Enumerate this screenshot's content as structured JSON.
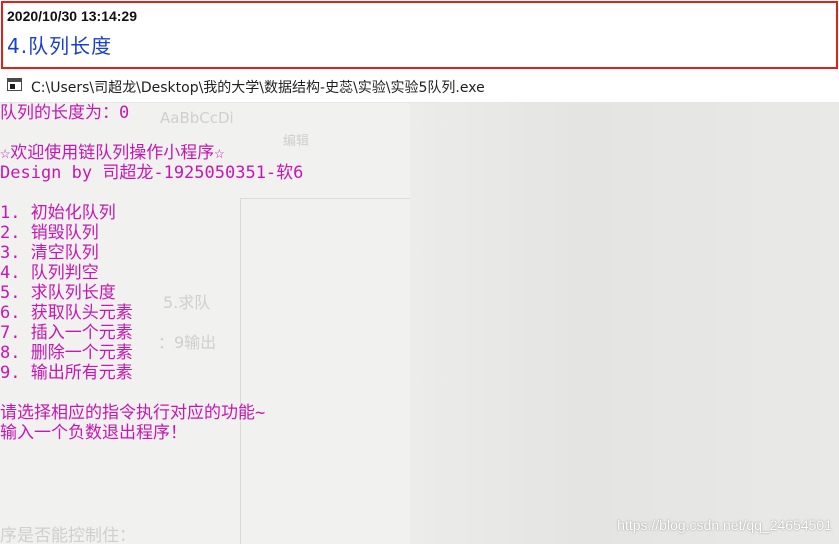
{
  "annotation": {
    "timestamp": "2020/10/30 13:14:29",
    "note": "4.队列长度"
  },
  "window": {
    "title": "C:\\Users\\司超龙\\Desktop\\我的大学\\数据结构-史蕊\\实验\\实验5队列.exe"
  },
  "console": {
    "lines": [
      "队列的长度为：0",
      "",
      "☆欢迎使用链队列操作小程序☆",
      "Design by 司超龙-1925050351-软6",
      "",
      "1. 初始化队列",
      "2. 销毁队列",
      "3. 清空队列",
      "4. 队列判空",
      "5. 求队列长度",
      "6. 获取队头元素",
      "7. 插入一个元素",
      "8. 删除一个元素",
      "9. 输出所有元素",
      "",
      "请选择相应的指令执行对应的功能~",
      "输入一个负数退出程序！"
    ]
  },
  "background_ghost": {
    "style_preview": "AaBbCcDi",
    "edit_label": "编辑",
    "menu_fragment_1": "5.求队",
    "menu_fragment_2": "：9输出",
    "bottom_fragment": "序是否能控制住："
  },
  "watermark": "https://blog.csdn.net/qq_24654501",
  "colors": {
    "console_text": "#c716b4",
    "annotation_border": "#e0201b",
    "annotation_note": "#1a3fd0",
    "console_background": "#f1f1f0"
  },
  "icons": {
    "title_icon": "console-window-icon"
  }
}
